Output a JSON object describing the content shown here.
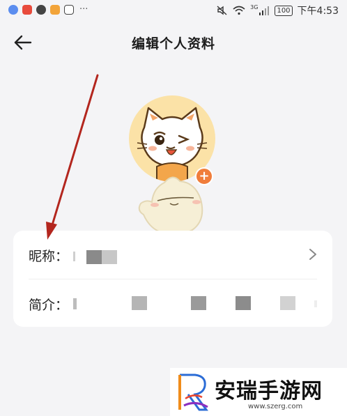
{
  "status_bar": {
    "time": "下午4:53",
    "battery": "100",
    "network": "3G",
    "more_glyph": "···",
    "app_icon_colors": [
      "#5b8def",
      "#e84b3c",
      "#e8404a",
      "#f2a43a",
      "#333333"
    ]
  },
  "header": {
    "title": "编辑个人资料",
    "back_icon": "back-arrow-icon"
  },
  "avatar": {
    "badge": "+",
    "bg_color": "#fbe2a7",
    "badge_color": "#f07d3b"
  },
  "profile_rows": [
    {
      "label": "昵称：",
      "value_censored": true
    },
    {
      "label": "简介：",
      "value_censored": true
    }
  ],
  "annotation": {
    "color": "#b3261e"
  },
  "watermark": {
    "name": "安瑞手游网",
    "url": "www.szerg.com"
  }
}
